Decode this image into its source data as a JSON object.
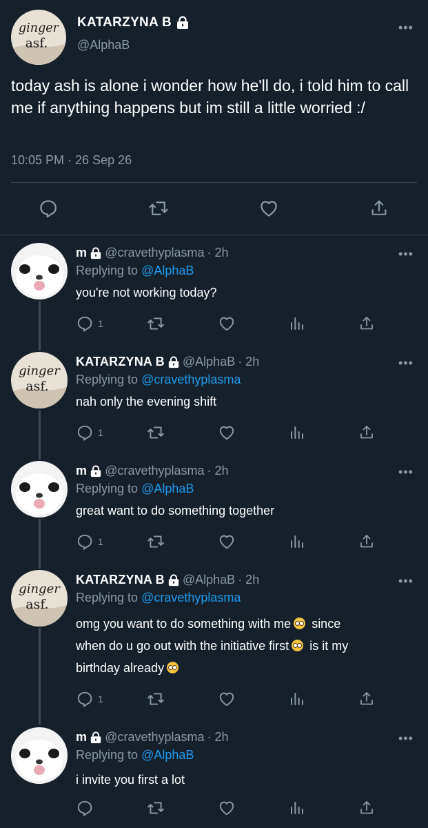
{
  "main_tweet": {
    "author_name": "KATARZYNA B",
    "author_handle": "@AlphaB",
    "avatar_text_line1": "ginger",
    "avatar_text_line2": "asf.",
    "text": "today ash is alone i wonder how he'll do, i told him to call me if anything happens but im still a little worried :/",
    "timestamp": "10:05 PM · 26 Sep 26",
    "more_label": "•••"
  },
  "replies": [
    {
      "name": "m",
      "handle": "@cravethyplasma",
      "time": "· 2h",
      "replying_prefix": "Replying to",
      "replying_to": "@AlphaB",
      "text": "you're not working today?",
      "reply_count": "1",
      "avatar": "cat"
    },
    {
      "name": "KATARZYNA B",
      "handle": "@AlphaB",
      "time": "· 2h",
      "replying_prefix": "Replying to",
      "replying_to": "@cravethyplasma",
      "text": "nah only the evening shift",
      "reply_count": "1",
      "avatar": "ginger"
    },
    {
      "name": "m",
      "handle": "@cravethyplasma",
      "time": "· 2h",
      "replying_prefix": "Replying to",
      "replying_to": "@AlphaB",
      "text": "great want to do something together",
      "reply_count": "1",
      "avatar": "cat"
    },
    {
      "name": "KATARZYNA B",
      "handle": "@AlphaB",
      "time": "· 2h",
      "replying_prefix": "Replying to",
      "replying_to": "@cravethyplasma",
      "text_line1": "omg you want to do something with me",
      "text_line1b": "since",
      "text_line2": "when do u go out with the initiative first",
      "text_line2b": "is it my",
      "text_line3": "birthday already",
      "reply_count": "1",
      "avatar": "ginger"
    },
    {
      "name": "m",
      "handle": "@cravethyplasma",
      "time": "· 2h",
      "replying_prefix": "Replying to",
      "replying_to": "@AlphaB",
      "text": "i invite you first a lot",
      "reply_count": "",
      "avatar": "cat"
    }
  ],
  "colors": {
    "background": "#15202b",
    "link": "#1d9bf0",
    "muted": "#8b98a5",
    "divider": "#38444d"
  },
  "icons": {
    "reply": "reply-icon",
    "retweet": "retweet-icon",
    "like": "heart-icon",
    "views": "views-icon",
    "share": "share-icon",
    "lock": "lock-icon",
    "more": "more-icon",
    "emoji": "pleading-face-emoji"
  }
}
